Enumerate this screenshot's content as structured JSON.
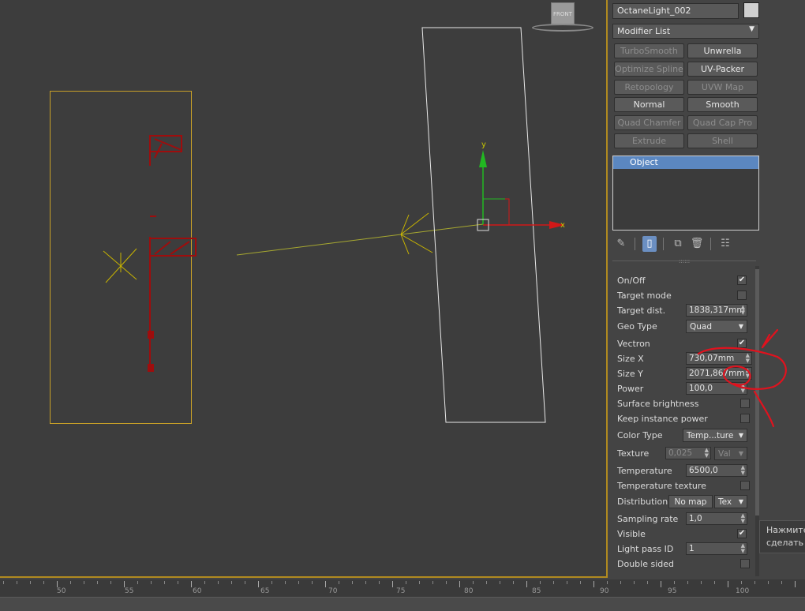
{
  "viewcube": {
    "label": "FRONT"
  },
  "gizmo": {
    "y_axis": "y",
    "x_axis": "x"
  },
  "panel": {
    "object_name": "OctaneLight_002",
    "color_swatch": "#d0d0d0",
    "modifier_list": "Modifier List",
    "modifier_buttons": [
      {
        "label": "TurboSmooth",
        "dim": true
      },
      {
        "label": "Unwrella",
        "dim": false
      },
      {
        "label": "Optimize Spline",
        "dim": true
      },
      {
        "label": "UV-Packer",
        "dim": false
      },
      {
        "label": "Retopology",
        "dim": true
      },
      {
        "label": "UVW Map",
        "dim": true
      },
      {
        "label": "Normal",
        "dim": false
      },
      {
        "label": "Smooth",
        "dim": false
      },
      {
        "label": "Quad Chamfer",
        "dim": true
      },
      {
        "label": "Quad Cap Pro",
        "dim": true
      },
      {
        "label": "Extrude",
        "dim": true
      },
      {
        "label": "Shell",
        "dim": true
      }
    ],
    "stack_selected": "Object",
    "toolbar_icons": [
      "pin-stack-icon",
      "show-end-result-icon",
      "make-unique-icon",
      "remove-modifier-icon",
      "configure-modifier-sets-icon"
    ]
  },
  "params": {
    "on_off": {
      "label": "On/Off",
      "checked": true
    },
    "target_mode": {
      "label": "Target mode",
      "checked": false
    },
    "target_dist": {
      "label": "Target dist.",
      "value": "1838,317mm"
    },
    "geo_type": {
      "label": "Geo Type",
      "value": "Quad"
    },
    "vectron": {
      "label": "Vectron",
      "checked": true
    },
    "size_x": {
      "label": "Size X",
      "value": "730,07mm"
    },
    "size_y": {
      "label": "Size Y",
      "value": "2071,867mm"
    },
    "power": {
      "label": "Power",
      "value": "100,0"
    },
    "surface_brightness": {
      "label": "Surface brightness",
      "checked": false
    },
    "keep_instance_power": {
      "label": "Keep instance power",
      "checked": false
    },
    "color_type": {
      "label": "Color Type",
      "value": "Temp...ture"
    },
    "texture": {
      "label": "Texture",
      "value": "0,025",
      "mode": "Val"
    },
    "temperature": {
      "label": "Temperature",
      "value": "6500,0"
    },
    "temperature_texture": {
      "label": "Temperature texture",
      "checked": false
    },
    "distribution": {
      "label": "Distribution",
      "map": "No map",
      "mode": "Tex"
    },
    "sampling_rate": {
      "label": "Sampling rate",
      "value": "1,0"
    },
    "visible": {
      "label": "Visible",
      "checked": true
    },
    "light_pass_id": {
      "label": "Light pass ID",
      "value": "1"
    },
    "double_sided": {
      "label": "Double sided",
      "checked": false
    }
  },
  "tooltip": {
    "line1": "Нажмите",
    "line2": "сделать с"
  },
  "timeline": {
    "ticks": [
      "50",
      "55",
      "60",
      "65",
      "70",
      "75",
      "80",
      "85",
      "90",
      "95",
      "100"
    ]
  },
  "colors": {
    "selection": "#b08a20",
    "light_gizmo": "#c8b400",
    "red_object": "#9e0d0d",
    "annotation": "#e0121e"
  }
}
